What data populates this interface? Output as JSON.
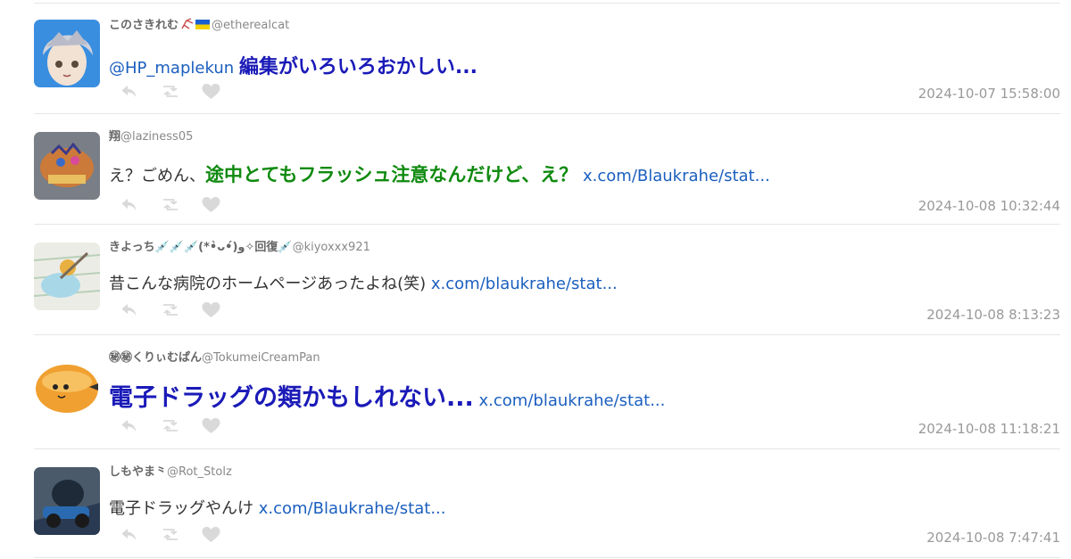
{
  "tweets": [
    {
      "name": "このさきれむ",
      "handle": "@etherealcat",
      "mention": "@HP_maplekun",
      "text": "編集がいろいろおかしい...",
      "link": "",
      "timestamp": "2024-10-07 15:58:00"
    },
    {
      "name": "翔",
      "handle": "@laziness05",
      "prefix": "え？ごめん、",
      "text": "途中とてもフラッシュ注意なんだけど、え？",
      "link": "x.com/Blaukrahe/stat...",
      "timestamp": "2024-10-08 10:32:44"
    },
    {
      "name": "きよっち💉💉💉(*•̀ᴗ•́)و✧回復💉",
      "handle": "@kiyoxxx921",
      "text": "昔こんな病院のホームページあったよね(笑)",
      "link": "x.com/blaukrahe/stat...",
      "timestamp": "2024-10-08 8:13:23"
    },
    {
      "name": "㊙㊙くりぃむぱん",
      "handle": "@TokumeiCreamPan",
      "text": "電子ドラッグの類かもしれない...",
      "link": "x.com/blaukrahe/stat...",
      "timestamp": "2024-10-08 11:18:21"
    },
    {
      "name": "しもやま",
      "name_suffix": "⺀",
      "handle": "@Rot_Stolz",
      "text": "電子ドラッグやんけ",
      "link": "x.com/Blaukrahe/stat...",
      "timestamp": "2024-10-08 7:47:41"
    }
  ],
  "icons": [
    "reply-icon",
    "retweet-icon",
    "like-icon"
  ],
  "colors": {
    "link": "#1b5fbf",
    "emphasis_blue": "#1a1ab8",
    "emphasis_green": "#0f8a0f",
    "icon": "#d6d6d6"
  }
}
